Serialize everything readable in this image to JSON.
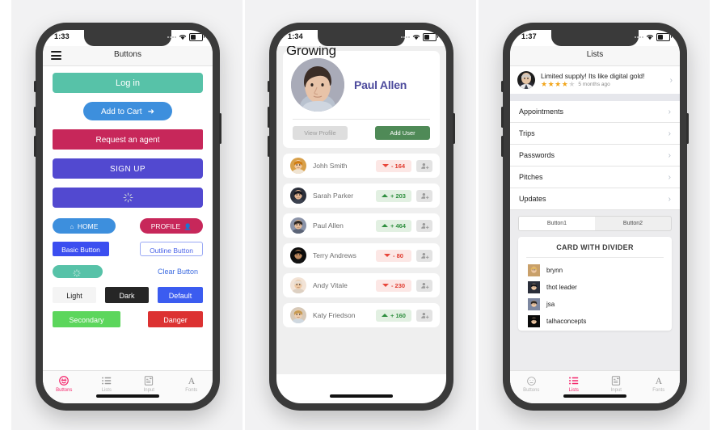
{
  "phone1": {
    "status": {
      "time": "1:33"
    },
    "navbar": {
      "title": "Buttons",
      "menu_icon": "hamburger-icon"
    },
    "buttons": {
      "login": "Log in",
      "add_to_cart": "Add to Cart",
      "add_to_cart_icon": "arrow-right-icon",
      "request_agent": "Request an agent",
      "sign_up": "SIGN UP",
      "loading_icon": "spinner-icon",
      "home": "HOME",
      "home_icon": "home-icon",
      "profile": "PROFILE",
      "profile_icon": "person-icon",
      "basic": "Basic Button",
      "outline": "Outline Button",
      "clear": "Clear Button",
      "light": "Light",
      "dark": "Dark",
      "default": "Default",
      "secondary": "Secondary",
      "danger": "Danger"
    },
    "colors": {
      "login": "#57c2a8",
      "add_to_cart": "#3d8fdd",
      "request_agent": "#c7275a",
      "sign_up": "#5249d0",
      "home": "#3d8fdd",
      "profile": "#c7275a",
      "basic": "#3b4ef0",
      "outline_text": "#4a63e8",
      "clear_text": "#3b6ae0",
      "light": "#f4f4f4",
      "dark": "#262626",
      "default": "#3b5cf0",
      "secondary": "#5cd65c",
      "danger": "#dc3232"
    },
    "tabs": [
      {
        "label": "Buttons",
        "icon": "smiley-icon",
        "active": true
      },
      {
        "label": "Lists",
        "icon": "list-icon",
        "active": false
      },
      {
        "label": "Input",
        "icon": "clipboard-icon",
        "active": false
      },
      {
        "label": "Fonts",
        "icon": "letter-a-icon",
        "active": false
      }
    ]
  },
  "phone2": {
    "status": {
      "time": "1:34"
    },
    "title": "Growing",
    "profile": {
      "name": "Paul Allen",
      "view_profile": "View Profile",
      "add_user": "Add User",
      "avatar": "avatar-paul-allen"
    },
    "users": [
      {
        "name": "Johh Smith",
        "value": "- 164",
        "dir": "down"
      },
      {
        "name": "Sarah Parker",
        "value": "+ 203",
        "dir": "up"
      },
      {
        "name": "Paul Allen",
        "value": "+ 464",
        "dir": "up"
      },
      {
        "name": "Terry Andrews",
        "value": "- 80",
        "dir": "down"
      },
      {
        "name": "Andy Vitale",
        "value": "- 230",
        "dir": "down"
      },
      {
        "name": "Katy Friedson",
        "value": "+ 160",
        "dir": "up"
      }
    ],
    "add_user_icon": "person-add-icon",
    "colors": {
      "name": "#4c4a9c",
      "add_user": "#4f8a57",
      "up": "#2f8f3f",
      "down": "#e03b2f"
    }
  },
  "phone3": {
    "status": {
      "time": "1:37"
    },
    "navbar": {
      "title": "Lists"
    },
    "review": {
      "text": "Limited supply! Its like digital gold!",
      "stars_filled": 4,
      "stars_total": 5,
      "time": "5 months ago",
      "avatar": "avatar-reviewer",
      "chevron": "chevron-right-icon"
    },
    "list_items": [
      {
        "label": "Appointments"
      },
      {
        "label": "Trips"
      },
      {
        "label": "Passwords"
      },
      {
        "label": "Pitches"
      },
      {
        "label": "Updates"
      }
    ],
    "segment": {
      "options": [
        "Button1",
        "Button2"
      ],
      "selected": "Button1"
    },
    "card": {
      "title": "CARD WITH DIVIDER",
      "rows": [
        {
          "name": "brynn"
        },
        {
          "name": "thot leader"
        },
        {
          "name": "jsa"
        },
        {
          "name": "talhaconcepts"
        }
      ]
    },
    "tabs": [
      {
        "label": "Buttons",
        "icon": "smiley-icon",
        "active": false
      },
      {
        "label": "Lists",
        "icon": "list-icon",
        "active": true
      },
      {
        "label": "Input",
        "icon": "clipboard-icon",
        "active": false
      },
      {
        "label": "Fonts",
        "icon": "letter-a-icon",
        "active": false
      }
    ]
  }
}
